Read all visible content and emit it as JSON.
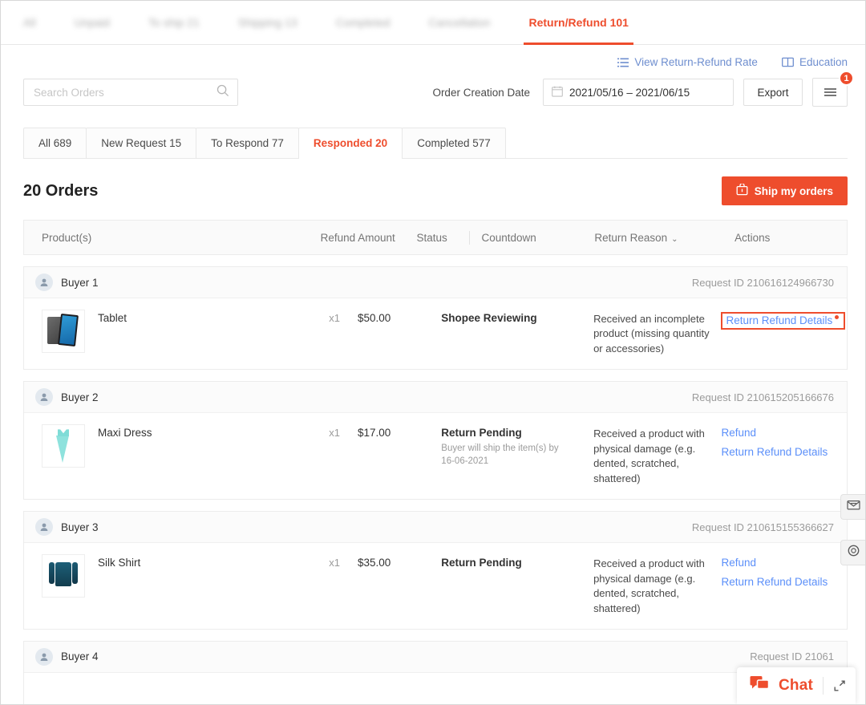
{
  "top_tabs": [
    {
      "label": "All",
      "active": false,
      "blurred": true
    },
    {
      "label": "Unpaid",
      "active": false,
      "blurred": true
    },
    {
      "label": "To ship 21",
      "active": false,
      "blurred": true
    },
    {
      "label": "Shipping 13",
      "active": false,
      "blurred": true
    },
    {
      "label": "Completed",
      "active": false,
      "blurred": true
    },
    {
      "label": "Cancellation",
      "active": false,
      "blurred": true
    },
    {
      "label": "Return/Refund 101",
      "active": true,
      "blurred": false
    }
  ],
  "utility_links": [
    {
      "label": "View Return-Refund Rate",
      "icon": "list-icon"
    },
    {
      "label": "Education",
      "icon": "book-icon"
    }
  ],
  "search": {
    "placeholder": "Search Orders",
    "value": "",
    "icon": "search-icon"
  },
  "date_filter": {
    "label": "Order Creation Date",
    "value": "2021/05/16 – 2021/06/15",
    "icon": "calendar-icon"
  },
  "export_button": {
    "label": "Export"
  },
  "filter_button": {
    "icon": "hamburger-icon",
    "badge": "1"
  },
  "sub_tabs": [
    {
      "label": "All 689",
      "active": false
    },
    {
      "label": "New Request 15",
      "active": false
    },
    {
      "label": "To Respond 77",
      "active": false
    },
    {
      "label": "Responded 20",
      "active": true
    },
    {
      "label": "Completed 577",
      "active": false
    }
  ],
  "orders_header": {
    "count_label": "20 Orders",
    "ship_button": "Ship my orders",
    "ship_button_icon": "package-icon"
  },
  "table_headers": {
    "product": "Product(s)",
    "refund_amount": "Refund Amount",
    "status": "Status",
    "countdown": "Countdown",
    "return_reason": "Return Reason",
    "return_reason_caret": "⌄",
    "actions": "Actions"
  },
  "orders": [
    {
      "buyer": "Buyer 1",
      "request_id": "Request ID 210616124966730",
      "product": "Tablet",
      "thumb": "tablet-thumbnail",
      "qty": "x1",
      "amount": "$50.00",
      "status": "Shopee Reviewing",
      "countdown": "",
      "reason": "Received an incomplete product (missing quantity or accessories)",
      "actions": [
        {
          "label": "Return Refund Details",
          "highlighted": true,
          "dot": true
        }
      ]
    },
    {
      "buyer": "Buyer 2",
      "request_id": "Request ID 210615205166676",
      "product": "Maxi Dress",
      "thumb": "dress-thumbnail",
      "qty": "x1",
      "amount": "$17.00",
      "status": "Return Pending",
      "countdown": "Buyer will ship the item(s) by 16-06-2021",
      "reason": "Received a product with physical damage (e.g. dented, scratched, shattered)",
      "actions": [
        {
          "label": "Refund",
          "highlighted": false,
          "dot": false
        },
        {
          "label": "Return Refund Details",
          "highlighted": false,
          "dot": false
        }
      ]
    },
    {
      "buyer": "Buyer 3",
      "request_id": "Request ID 210615155366627",
      "product": "Silk Shirt",
      "thumb": "shirt-thumbnail",
      "qty": "x1",
      "amount": "$35.00",
      "status": "Return Pending",
      "countdown": "",
      "reason": "Received a product with physical damage (e.g. dented, scratched, shattered)",
      "actions": [
        {
          "label": "Refund",
          "highlighted": false,
          "dot": false
        },
        {
          "label": "Return Refund Details",
          "highlighted": false,
          "dot": false
        }
      ]
    },
    {
      "buyer": "Buyer 4",
      "request_id": "Request ID 21061",
      "product": "",
      "thumb": "",
      "qty": "",
      "amount": "",
      "status": "",
      "countdown": "",
      "reason": "",
      "actions": []
    }
  ],
  "side_widgets": [
    {
      "icon": "mail-icon"
    },
    {
      "icon": "support-circle-icon"
    }
  ],
  "chat_widget": {
    "label": "Chat",
    "icon": "chat-bubble-icon",
    "expand_icon": "expand-arrow-icon"
  },
  "colors": {
    "accent": "#ee4d2d",
    "link": "#5b8ff9",
    "util_link": "#6e8ecf"
  }
}
